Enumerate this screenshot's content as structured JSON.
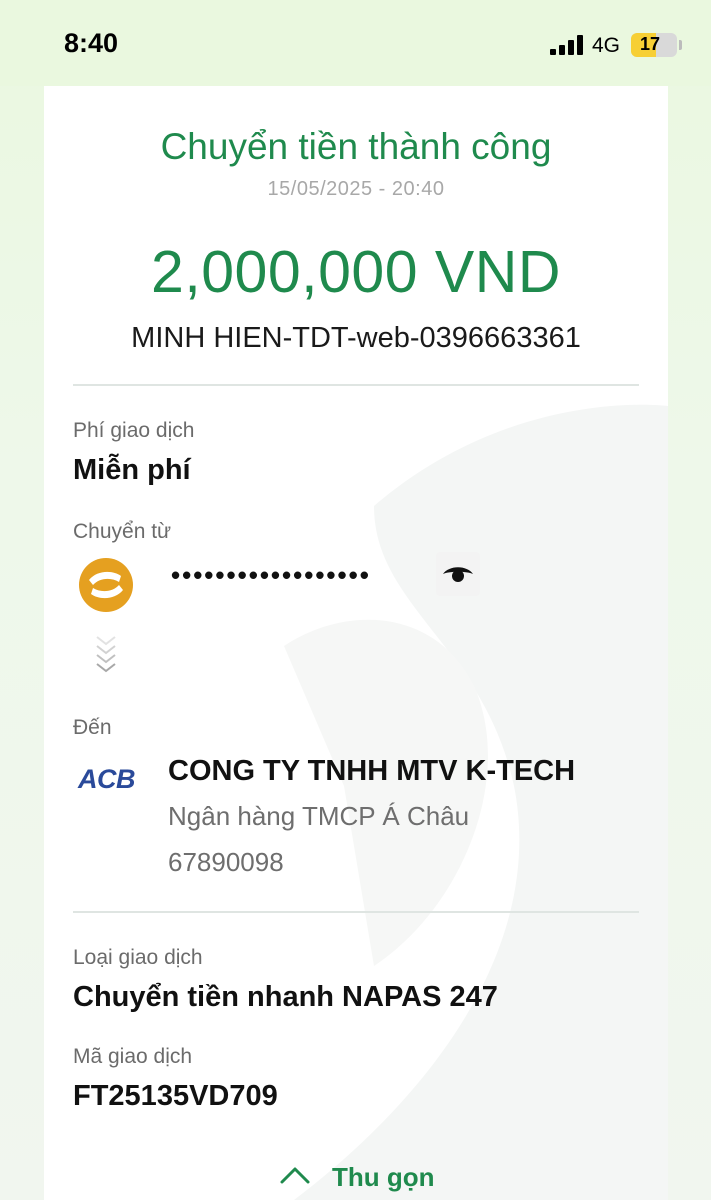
{
  "status_bar": {
    "time": "8:40",
    "network": "4G",
    "battery": "17",
    "battery_level_percent": 17
  },
  "receipt": {
    "title": "Chuyển tiền thành công",
    "datetime": "15/05/2025 - 20:40",
    "amount": "2,000,000 VND",
    "memo": "MINH HIEN-TDT-web-0396663361",
    "fee": {
      "label": "Phí giao dịch",
      "value": "Miễn phí"
    },
    "from": {
      "label": "Chuyển từ",
      "account_masked": "••••••••••••••••••",
      "bank_icon": "bank-logo-icon",
      "visibility_icon": "eye-icon"
    },
    "to": {
      "label": "Đến",
      "bank_logo_text": "ACB",
      "name": "CONG TY TNHH MTV K-TECH",
      "bank": "Ngân hàng TMCP Á Châu",
      "account": "67890098"
    },
    "transaction_type": {
      "label": "Loại giao dịch",
      "value": "Chuyển tiền nhanh NAPAS 247"
    },
    "transaction_id": {
      "label": "Mã giao dịch",
      "value": "FT25135VD709"
    },
    "collapse_label": "Thu gọn"
  },
  "colors": {
    "accent_green": "#1f8a4d",
    "acb_blue": "#2a4a9a",
    "bank_logo_gold": "#e5a020"
  }
}
